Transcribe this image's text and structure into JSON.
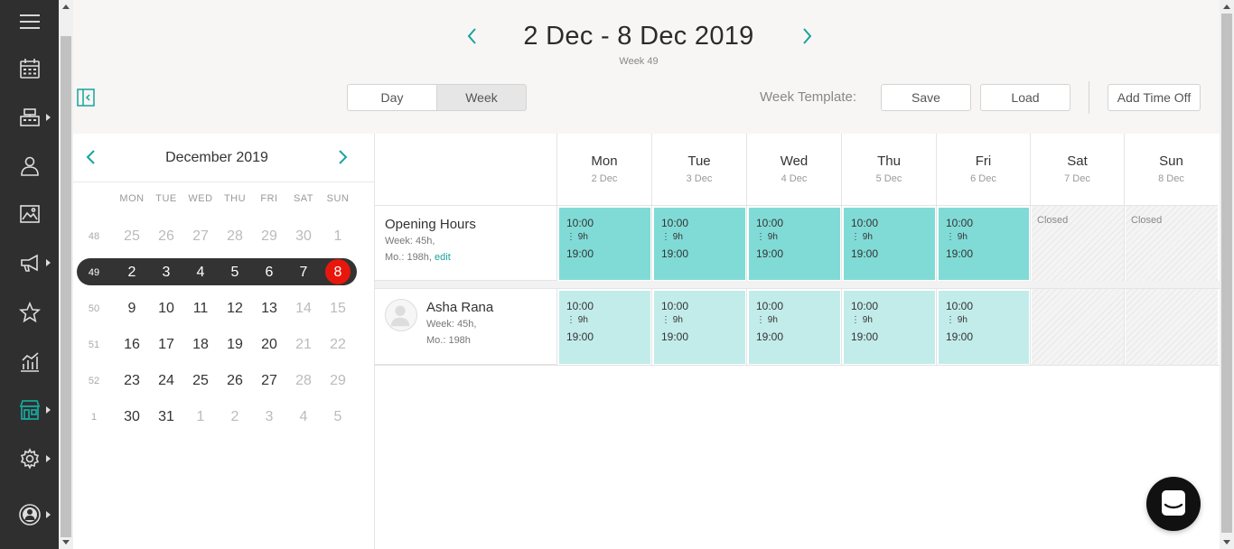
{
  "sidebar": {
    "items": [
      {
        "icon": "menu-icon"
      },
      {
        "icon": "calendar-icon"
      },
      {
        "icon": "register-icon",
        "has_submenu": true
      },
      {
        "icon": "clients-icon"
      },
      {
        "icon": "gallery-icon"
      },
      {
        "icon": "megaphone-icon",
        "has_submenu": true
      },
      {
        "icon": "star-icon"
      },
      {
        "icon": "reports-icon"
      },
      {
        "icon": "store-icon",
        "has_submenu": true,
        "active": true
      },
      {
        "icon": "gear-icon",
        "has_submenu": true
      },
      {
        "icon": "profile-icon",
        "has_submenu": true
      }
    ],
    "active_color": "#17a49b"
  },
  "header": {
    "range_title": "2 Dec - 8 Dec 2019",
    "week_label": "Week 49",
    "view_day": "Day",
    "view_week": "Week",
    "active_view": "Week",
    "template_label": "Week Template:",
    "save_label": "Save",
    "load_label": "Load",
    "time_off_label": "Add Time Off"
  },
  "mini_calendar": {
    "month_label": "December 2019",
    "weekdays": [
      "MON",
      "TUE",
      "WED",
      "THU",
      "FRI",
      "SAT",
      "SUN"
    ],
    "weeks": [
      {
        "num": "48",
        "days": [
          "25",
          "26",
          "27",
          "28",
          "29",
          "30",
          "1"
        ]
      },
      {
        "num": "49",
        "days": [
          "2",
          "3",
          "4",
          "5",
          "6",
          "7",
          "8"
        ]
      },
      {
        "num": "50",
        "days": [
          "9",
          "10",
          "11",
          "12",
          "13",
          "14",
          "15"
        ]
      },
      {
        "num": "51",
        "days": [
          "16",
          "17",
          "18",
          "19",
          "20",
          "21",
          "22"
        ]
      },
      {
        "num": "52",
        "days": [
          "23",
          "24",
          "25",
          "26",
          "27",
          "28",
          "29"
        ]
      },
      {
        "num": "1",
        "days": [
          "30",
          "31",
          "1",
          "2",
          "3",
          "4",
          "5"
        ]
      }
    ],
    "selected_week": "49",
    "today": "8",
    "today_color": "#e8170c"
  },
  "schedule": {
    "columns": [
      {
        "day": "Mon",
        "date": "2 Dec"
      },
      {
        "day": "Tue",
        "date": "3 Dec"
      },
      {
        "day": "Wed",
        "date": "4 Dec"
      },
      {
        "day": "Thu",
        "date": "5 Dec"
      },
      {
        "day": "Fri",
        "date": "6 Dec"
      },
      {
        "day": "Sat",
        "date": "7 Dec"
      },
      {
        "day": "Sun",
        "date": "8 Dec"
      }
    ],
    "opening_hours": {
      "title": "Opening Hours",
      "week_total": "Week: 45h,",
      "month_total": "Mo.: 198h,",
      "edit_label": "edit",
      "shifts": [
        {
          "start": "10:00",
          "duration": "9h",
          "end": "19:00"
        },
        {
          "start": "10:00",
          "duration": "9h",
          "end": "19:00"
        },
        {
          "start": "10:00",
          "duration": "9h",
          "end": "19:00"
        },
        {
          "start": "10:00",
          "duration": "9h",
          "end": "19:00"
        },
        {
          "start": "10:00",
          "duration": "9h",
          "end": "19:00"
        }
      ],
      "closed_label": "Closed"
    },
    "employee": {
      "name": "Asha Rana",
      "week_total": "Week: 45h,",
      "month_total": "Mo.: 198h",
      "shifts": [
        {
          "start": "10:00",
          "duration": "9h",
          "end": "19:00"
        },
        {
          "start": "10:00",
          "duration": "9h",
          "end": "19:00"
        },
        {
          "start": "10:00",
          "duration": "9h",
          "end": "19:00"
        },
        {
          "start": "10:00",
          "duration": "9h",
          "end": "19:00"
        },
        {
          "start": "10:00",
          "duration": "9h",
          "end": "19:00"
        }
      ]
    },
    "colors": {
      "opening_shift": "#80dbd7",
      "employee_shift": "#c2ecea",
      "accent": "#17a49b"
    }
  }
}
